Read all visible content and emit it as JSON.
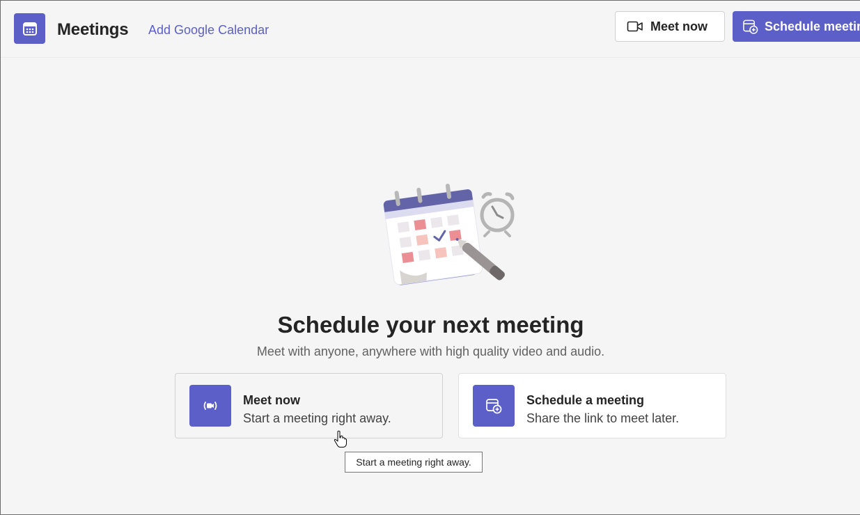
{
  "header": {
    "app_icon": "calendar-icon",
    "title": "Meetings",
    "add_calendar_link": "Add Google Calendar",
    "meet_now_label": "Meet now",
    "meet_now_icon": "video-camera-icon",
    "schedule_label": "Schedule meeting",
    "schedule_icon": "calendar-add-icon"
  },
  "main": {
    "heading": "Schedule your next meeting",
    "subheading": "Meet with anyone, anywhere with high quality video and audio.",
    "cards": [
      {
        "title": "Meet now",
        "description": "Start a meeting right away.",
        "icon": "video-icon"
      },
      {
        "title": "Schedule a meeting",
        "description": "Share the link to meet later.",
        "icon": "calendar-add-icon"
      }
    ],
    "tooltip": "Start a meeting right away."
  },
  "colors": {
    "accent": "#5b5fc7",
    "background": "#f5f5f5",
    "card": "#ffffff"
  }
}
